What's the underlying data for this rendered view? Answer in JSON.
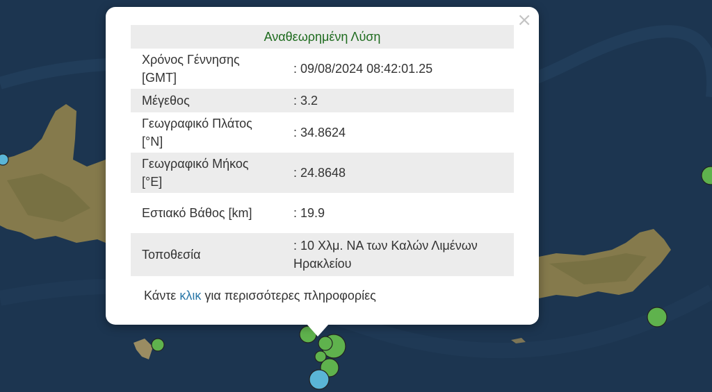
{
  "popup": {
    "close_label": "×",
    "title": "Αναθεωρημένη Λύση",
    "rows": [
      {
        "label": "Χρόνος Γέννησης [GMT]",
        "value": ": 09/08/2024 08:42:01.25"
      },
      {
        "label": "Μέγεθος",
        "value": ": 3.2"
      },
      {
        "label": "Γεωγραφικό Πλάτος [°N]",
        "value": ": 34.8624"
      },
      {
        "label": "Γεωγραφικό Μήκος [°E]",
        "value": ": 24.8648"
      },
      {
        "label": "Εστιακό Βάθος [km]",
        "value": ": 19.9"
      },
      {
        "label": "Τοποθεσία",
        "value": ": 10 Χλμ. ΝΑ των Καλών Λιμένων Ηρακλείου"
      }
    ],
    "footer": {
      "before": "Κάντε ",
      "link": "κλικ",
      "after": " για περισσότερες πληροφορίες"
    }
  },
  "colors": {
    "recent_event": "#5fb24d",
    "older_event": "#5ab5d6",
    "sea": "#1c3550",
    "land": "#8a8050"
  }
}
